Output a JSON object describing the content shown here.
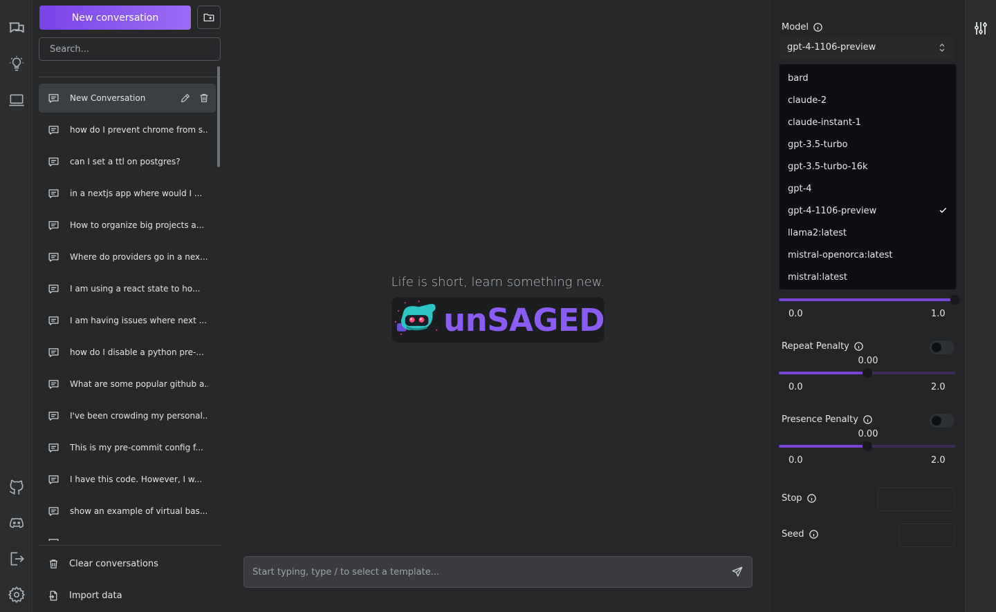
{
  "sidebar": {
    "new_conversation_label": "New conversation",
    "search_placeholder": "Search...",
    "conversations": [
      "New Conversation",
      "how do I prevent chrome from s...",
      "can I set a ttl on postgres?",
      "in a nextjs app where would I ...",
      "How to organize big projects a...",
      "Where do providers go in a nex...",
      "I am using a react state to ho...",
      "I am having issues where next ...",
      "how do I disable a python pre-...",
      "What are some popular github a...",
      "I've been crowding my personal...",
      "This is my pre-commit config f...",
      "I have this code. However, I w...",
      "show an example of virtual bas...",
      "..."
    ],
    "footer": {
      "clear_label": "Clear conversations",
      "import_label": "Import data"
    }
  },
  "main": {
    "tagline": "Life is short, learn something new.",
    "logo_text": "unSAGED",
    "input_placeholder": "Start typing, type / to select a template..."
  },
  "settings": {
    "model_label": "Model",
    "model_selected": "gpt-4-1106-preview",
    "model_options": [
      "bard",
      "claude-2",
      "claude-instant-1",
      "gpt-3.5-turbo",
      "gpt-3.5-turbo-16k",
      "gpt-4",
      "gpt-4-1106-preview",
      "llama2:latest",
      "mistral-openorca:latest",
      "mistral:latest"
    ],
    "top_slider": {
      "value": 1.0,
      "min_label": "0.0",
      "max_label": "1.0"
    },
    "repeat_penalty": {
      "label": "Repeat Penalty",
      "value": "0.00",
      "fraction": 0.5,
      "min_label": "0.0",
      "max_label": "2.0"
    },
    "presence_penalty": {
      "label": "Presence Penalty",
      "value": "0.00",
      "fraction": 0.5,
      "min_label": "0.0",
      "max_label": "2.0"
    },
    "stop_label": "Stop",
    "seed_label": "Seed"
  },
  "colors": {
    "accent": "#7a45d9",
    "button_gradient_start": "#7a43e6",
    "button_gradient_end": "#9b6cf5"
  }
}
